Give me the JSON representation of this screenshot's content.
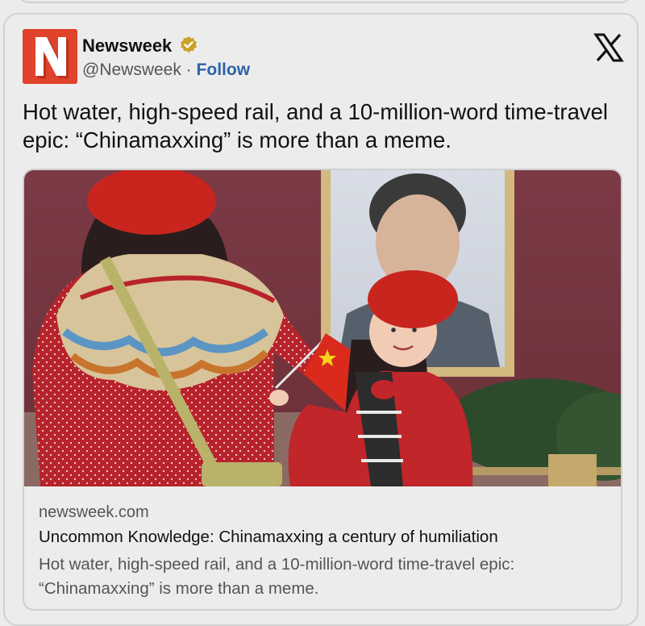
{
  "tweet": {
    "author_name": "Newsweek",
    "verified_icon": "verified-badge-icon",
    "handle": "@Newsweek",
    "separator": "·",
    "follow_label": "Follow",
    "logo_letter": "N",
    "close_icon": "x-logo-icon",
    "text": "Hot water, high-speed rail, and a 10-million-word time-travel epic: “Chinamaxxing” is more than a meme."
  },
  "link_card": {
    "domain": "newsweek.com",
    "title": "Uncommon Knowledge: Chinamaxxing a century of humiliation",
    "description": "Hot water, high-speed rail, and a 10-million-word time-travel epic: “Chinamaxxing” is more than a meme."
  },
  "colors": {
    "logo_red": "#e0422b",
    "follow_blue": "#2c63a8",
    "verified_gold": "#c9a227",
    "beret_red": "#c8251e"
  }
}
